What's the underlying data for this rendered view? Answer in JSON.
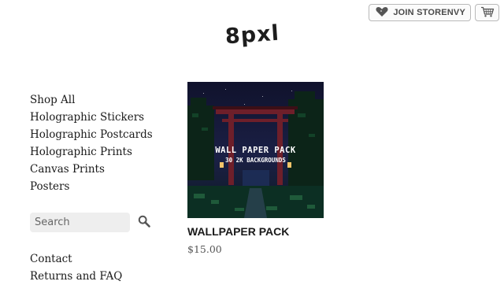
{
  "header": {
    "join_label": "JOIN STORENVY",
    "logo_text": "8pxl",
    "icons": {
      "join": "heart-icon",
      "cart": "cart-icon"
    }
  },
  "nav": {
    "items": [
      {
        "label": "Shop All"
      },
      {
        "label": "Holographic Stickers"
      },
      {
        "label": "Holographic Postcards"
      },
      {
        "label": "Holographic Prints"
      },
      {
        "label": "Canvas Prints"
      },
      {
        "label": "Posters"
      }
    ]
  },
  "search": {
    "placeholder": "Search",
    "icon": "search-icon"
  },
  "footer_nav": {
    "items": [
      {
        "label": "Contact"
      },
      {
        "label": "Returns and FAQ"
      }
    ]
  },
  "product": {
    "title": "WALLPAPER PACK",
    "price": "$15.00",
    "image_title": "WALL PAPER PACK",
    "image_subtitle": "30 2K BACKGROUNDS"
  },
  "colors": {
    "heart": "#555555",
    "image_sky": "#161a3a",
    "torii": "#6e1f2a"
  }
}
